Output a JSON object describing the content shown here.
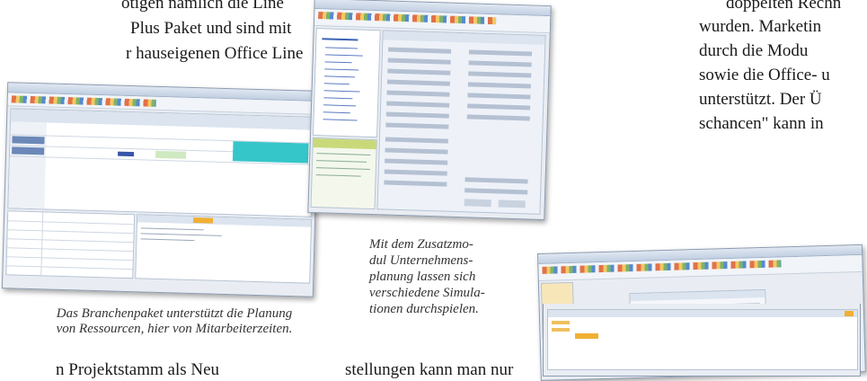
{
  "article": {
    "top_left": [
      "otigen nämlich die Line",
      "Plus Paket und sind mit",
      "r hauseigenen Office Line"
    ],
    "top_right": [
      "doppelten Rechn",
      "wurden. Marketin",
      "durch die Modu",
      "sowie die Office- u",
      "unterstützt. Der Ü",
      "schancen\" kann in"
    ],
    "bottom_left": "n Projektstamm als Neu",
    "bottom_mid": "stellungen kann man nur"
  },
  "captions": {
    "left": [
      "Das Branchenpaket unterstützt die Planung",
      "von Ressourcen, hier von Mitarbeiterzeiten."
    ],
    "middle": [
      "Mit dem Zusatzmo-",
      "dul Unternehmens-",
      "planung lassen sich",
      "verschiedene Simula-",
      "tionen durchspielen."
    ]
  },
  "screenshots": {
    "left": "Ressourcenplanung Mitarbeiterzeiten",
    "middle": "Unternehmensplanung Simulation",
    "right": "Office Line Anwendung"
  }
}
